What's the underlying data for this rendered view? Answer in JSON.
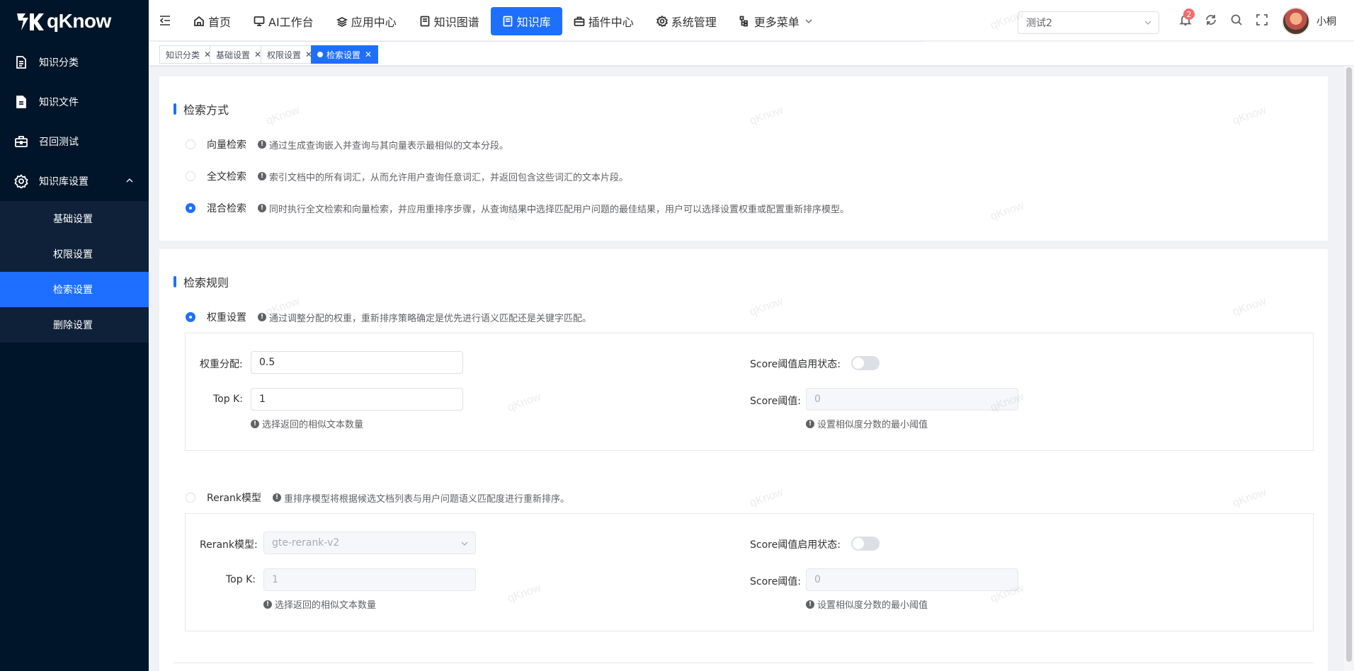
{
  "app": {
    "logo_text": "qKnow",
    "username": "小桐",
    "notifications": "2"
  },
  "sidebar": {
    "items": [
      {
        "label": "知识分类",
        "icon": "document-icon"
      },
      {
        "label": "知识文件",
        "icon": "file-icon"
      },
      {
        "label": "召回测试",
        "icon": "briefcase-icon"
      },
      {
        "label": "知识库设置",
        "icon": "gear-icon"
      }
    ],
    "subitems": [
      {
        "label": "基础设置"
      },
      {
        "label": "权限设置"
      },
      {
        "label": "检索设置"
      },
      {
        "label": "删除设置"
      }
    ]
  },
  "header": {
    "nav": [
      {
        "label": "首页",
        "icon": "home-icon"
      },
      {
        "label": "AI工作台",
        "icon": "monitor-icon"
      },
      {
        "label": "应用中心",
        "icon": "app-icon"
      },
      {
        "label": "知识图谱",
        "icon": "book-icon"
      },
      {
        "label": "知识库",
        "icon": "book-icon"
      },
      {
        "label": "插件中心",
        "icon": "toolbox-icon"
      },
      {
        "label": "系统管理",
        "icon": "gear-icon"
      },
      {
        "label": "更多菜单",
        "icon": "tree-icon"
      }
    ],
    "kb_select": "测试2"
  },
  "tags": [
    {
      "label": "知识分类"
    },
    {
      "label": "基础设置"
    },
    {
      "label": "权限设置"
    },
    {
      "label": "检索设置"
    }
  ],
  "search_method": {
    "title": "检索方式",
    "options": [
      {
        "label": "向量检索",
        "hint": "通过生成查询嵌入并查询与其向量表示最相似的文本分段。",
        "checked": false
      },
      {
        "label": "全文检索",
        "hint": "索引文档中的所有词汇，从而允许用户查询任意词汇，并返回包含这些词汇的文本片段。",
        "checked": false
      },
      {
        "label": "混合检索",
        "hint": "同时执行全文检索和向量检索，并应用重排序步骤，从查询结果中选择匹配用户问题的最佳结果，用户可以选择设置权重或配置重新排序模型。",
        "checked": true
      }
    ]
  },
  "search_rules": {
    "title": "检索规则",
    "weight": {
      "label": "权重设置",
      "hint": "通过调整分配的权重，重新排序策略确定是优先进行语义匹配还是关键字匹配。",
      "weight_label": "权重分配:",
      "weight_value": "0.5",
      "topk_label": "Top K:",
      "topk_value": "1",
      "topk_hint": "选择返回的相似文本数量",
      "score_switch_label": "Score阈值启用状态:",
      "score_label": "Score阈值:",
      "score_value": "0",
      "score_hint": "设置相似度分数的最小阈值"
    },
    "rerank": {
      "label": "Rerank模型",
      "hint": "重排序模型将根据候选文档列表与用户问题语义匹配度进行重新排序。",
      "model_label": "Rerank模型:",
      "model_value": "gte-rerank-v2",
      "topk_label": "Top K:",
      "topk_value": "1",
      "topk_hint": "选择返回的相似文本数量",
      "score_switch_label": "Score阈值启用状态:",
      "score_label": "Score阈值:",
      "score_value": "0",
      "score_hint": "设置相似度分数的最小阈值"
    }
  },
  "watermark": "qKnow"
}
